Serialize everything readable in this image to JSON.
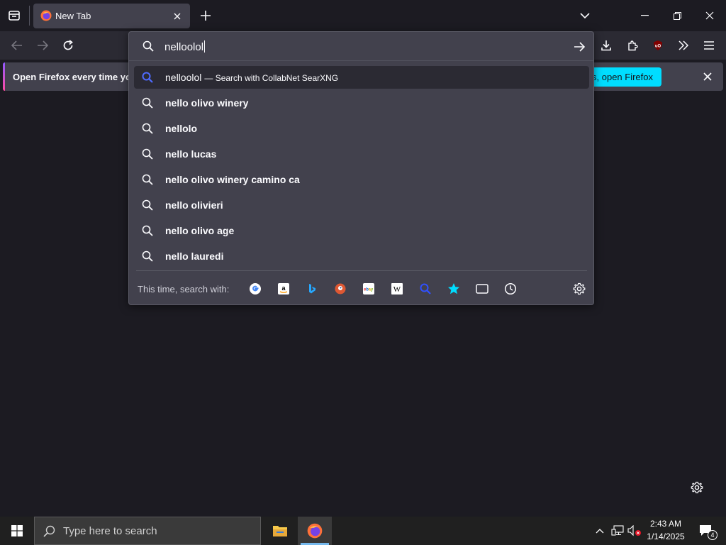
{
  "browser": {
    "tab_title": "New Tab",
    "url_input": "nelloolol"
  },
  "notification": {
    "text": "Open Firefox every time you",
    "button_label": "es, open Firefox"
  },
  "suggestions": {
    "selected": {
      "query": "nelloolol",
      "action": "— Search with CollabNet SearXNG"
    },
    "items": [
      "nello olivo winery",
      "nellolo",
      "nello lucas",
      "nello olivo winery camino ca",
      "nello olivieri",
      "nello olivo age",
      "nello lauredi"
    ]
  },
  "one_off": {
    "label": "This time, search with:",
    "engines": [
      "google-icon",
      "amazon-icon",
      "bing-icon",
      "duckduckgo-icon",
      "ebay-icon",
      "wikipedia-icon",
      "searxng-icon",
      "bookmarks-icon",
      "tabs-icon",
      "history-icon"
    ]
  },
  "taskbar": {
    "search_placeholder": "Type here to search",
    "time": "2:43 AM",
    "date": "1/14/2025",
    "notification_count": "4"
  },
  "colors": {
    "accent": "#00ddff",
    "popup_bg": "#42414d",
    "page_bg": "#1c1b22",
    "search_blue": "#4f6bff"
  }
}
